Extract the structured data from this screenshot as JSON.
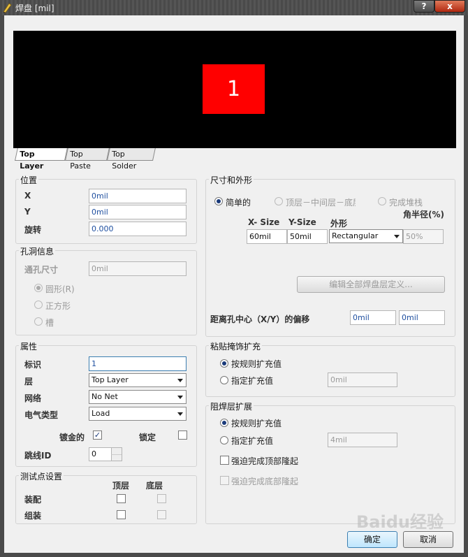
{
  "window": {
    "title": "焊盘 [mil]",
    "help_label": "?",
    "close_label": "x"
  },
  "preview": {
    "pad_number": "1",
    "pad_color": "#ff0000",
    "background": "#000000"
  },
  "tabs": [
    {
      "label": "Top Layer"
    },
    {
      "label": "Top Paste"
    },
    {
      "label": "Top Solder"
    }
  ],
  "position": {
    "title": "位置",
    "x_label": "X",
    "x_value": "0mil",
    "y_label": "Y",
    "y_value": "0mil",
    "rotation_label": "旋转",
    "rotation_value": "0.000"
  },
  "hole": {
    "title": "孔洞信息",
    "size_label": "通孔尺寸",
    "size_value": "0mil",
    "round_label": "圆形(R)",
    "square_label": "正方形",
    "slot_label": "槽"
  },
  "properties": {
    "title": "属性",
    "designator_label": "标识",
    "designator_value": "1",
    "layer_label": "层",
    "layer_value": "Top Layer",
    "net_label": "网络",
    "net_value": "No Net",
    "elec_label": "电气类型",
    "elec_value": "Load",
    "plated_label": "镀金的",
    "locked_label": "锁定",
    "jumper_label": "跳线ID",
    "jumper_value": "0"
  },
  "testpoint": {
    "title": "测试点设置",
    "top_label": "顶层",
    "bottom_label": "底层",
    "fab_label": "装配",
    "assy_label": "组装"
  },
  "size_shape": {
    "title": "尺寸和外形",
    "simple_label": "简单的",
    "tmb_label": "顶层－中间层－底层",
    "full_label": "完成堆栈",
    "corner_label": "角半径(%)",
    "xsize_label": "X- Size",
    "ysize_label": "Y-Size",
    "shape_label": "外形",
    "xsize_value": "60mil",
    "ysize_value": "50mil",
    "shape_value": "Rectangular",
    "corner_value": "50%",
    "edit_button": "编辑全部焊盘层定义...",
    "offset_label": "距离孔中心（X/Y）的偏移",
    "offset_x": "0mil",
    "offset_y": "0mil"
  },
  "paste": {
    "title": "粘贴掩饰扩充",
    "rule_label": "按规则扩充值",
    "specify_label": "指定扩充值",
    "specify_value": "0mil"
  },
  "solder": {
    "title": "阻焊层扩展",
    "rule_label": "按规则扩充值",
    "specify_label": "指定扩充值",
    "specify_value": "4mil",
    "force_top_label": "强迫完成顶部隆起",
    "force_bottom_label": "强迫完成底部隆起"
  },
  "buttons": {
    "ok": "确定",
    "cancel": "取消"
  },
  "watermark": "Baidu经验"
}
